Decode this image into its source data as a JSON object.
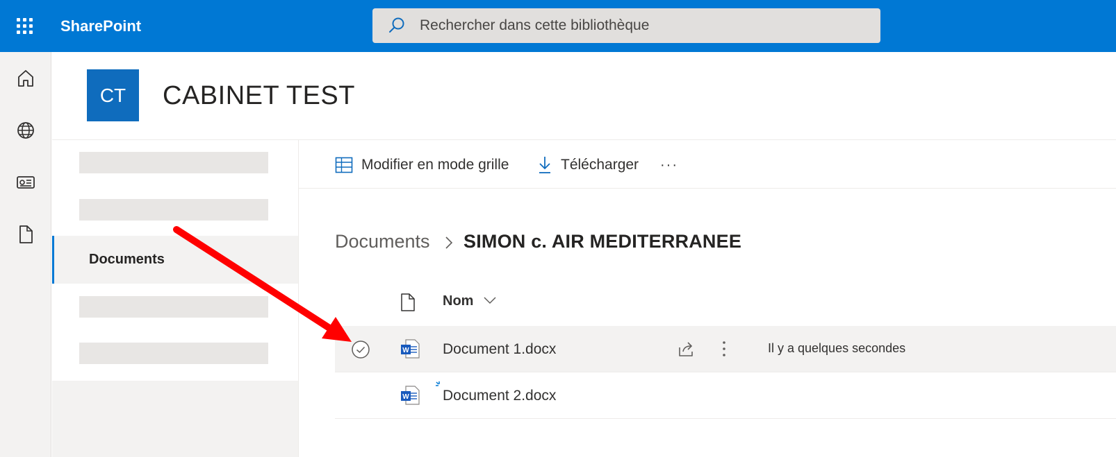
{
  "suite_bar": {
    "app_name": "SharePoint",
    "search_placeholder": "Rechercher dans cette bibliothèque",
    "accent_color": "#0078d4"
  },
  "left_rail": {
    "icons": [
      "home-icon",
      "globe-icon",
      "news-icon",
      "file-icon"
    ]
  },
  "site": {
    "logo_initials": "CT",
    "title": "CABINET TEST"
  },
  "site_nav": {
    "active_item": "Documents"
  },
  "command_bar": {
    "grid_label": "Modifier en mode grille",
    "download_label": "Télécharger",
    "more_label": "···"
  },
  "breadcrumb": {
    "root": "Documents",
    "current": "SIMON c. AIR MEDITERRANEE"
  },
  "list": {
    "name_column": "Nom",
    "files": [
      {
        "name": "Document 1.docx",
        "modified": "Il y a quelques secondes"
      },
      {
        "name": "Document 2.docx",
        "modified": ""
      }
    ]
  },
  "annotation_color": "#ff0000"
}
